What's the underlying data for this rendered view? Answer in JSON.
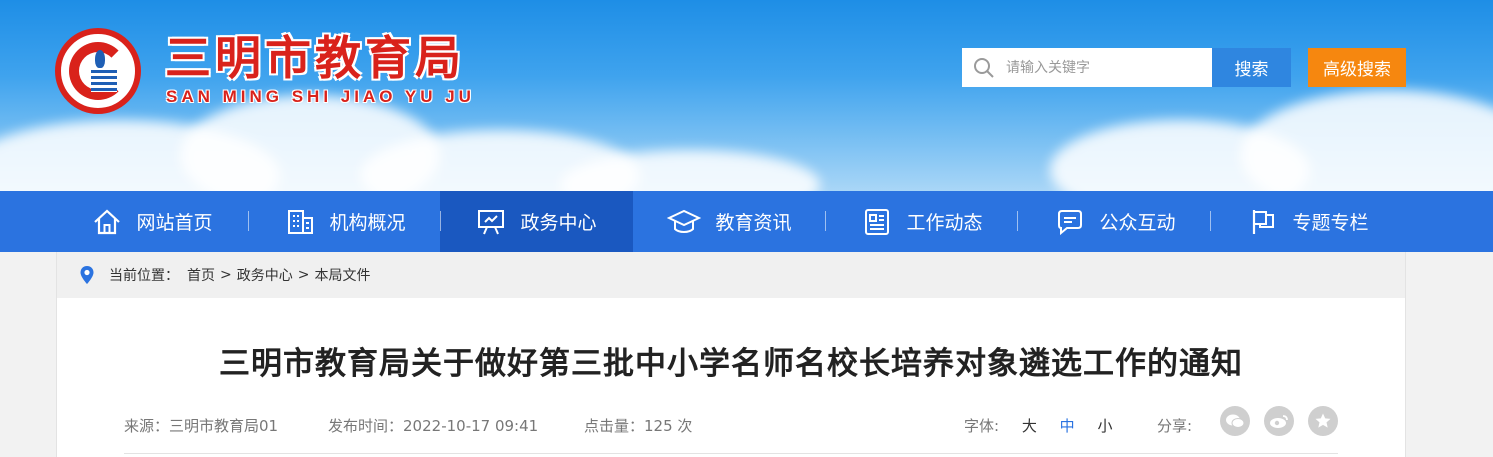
{
  "header": {
    "title": "三明市教育局",
    "subtitle": "SAN MING SHI JIAO YU JU",
    "search_placeholder": "请输入关键字",
    "search_label": "搜索",
    "advanced_search_label": "高级搜索",
    "colors": {
      "brand_red": "#d9221b",
      "search_blue": "#2f86e0",
      "advanced_orange": "#f6870f"
    }
  },
  "nav": {
    "items": [
      {
        "label": "网站首页",
        "icon": "home-icon"
      },
      {
        "label": "机构概况",
        "icon": "building-icon"
      },
      {
        "label": "政务中心",
        "icon": "presentation-icon",
        "active": true
      },
      {
        "label": "教育资讯",
        "icon": "graduation-cap-icon"
      },
      {
        "label": "工作动态",
        "icon": "newspaper-icon"
      },
      {
        "label": "公众互动",
        "icon": "chat-icon"
      },
      {
        "label": "专题专栏",
        "icon": "flag-icon"
      }
    ],
    "colors": {
      "bg": "#2b73e0",
      "active_bg": "#1a58c0"
    }
  },
  "breadcrumb": {
    "prefix": "当前位置：",
    "items": [
      "首页",
      "政务中心",
      "本局文件"
    ],
    "separator": ">"
  },
  "article": {
    "title": "三明市教育局关于做好第三批中小学名师名校长培养对象遴选工作的通知",
    "source_label": "来源：",
    "source": "三明市教育局01",
    "publish_label": "发布时间：",
    "publish_time": "2022-10-17 09:41",
    "hits_label": "点击量：",
    "hits": "125 次",
    "font_label": "字体:",
    "font_options": [
      "大",
      "中",
      "小"
    ],
    "font_selected": "中",
    "share_label": "分享:",
    "share_icons": [
      "wechat-icon",
      "weibo-icon",
      "favorite-star-icon"
    ]
  }
}
